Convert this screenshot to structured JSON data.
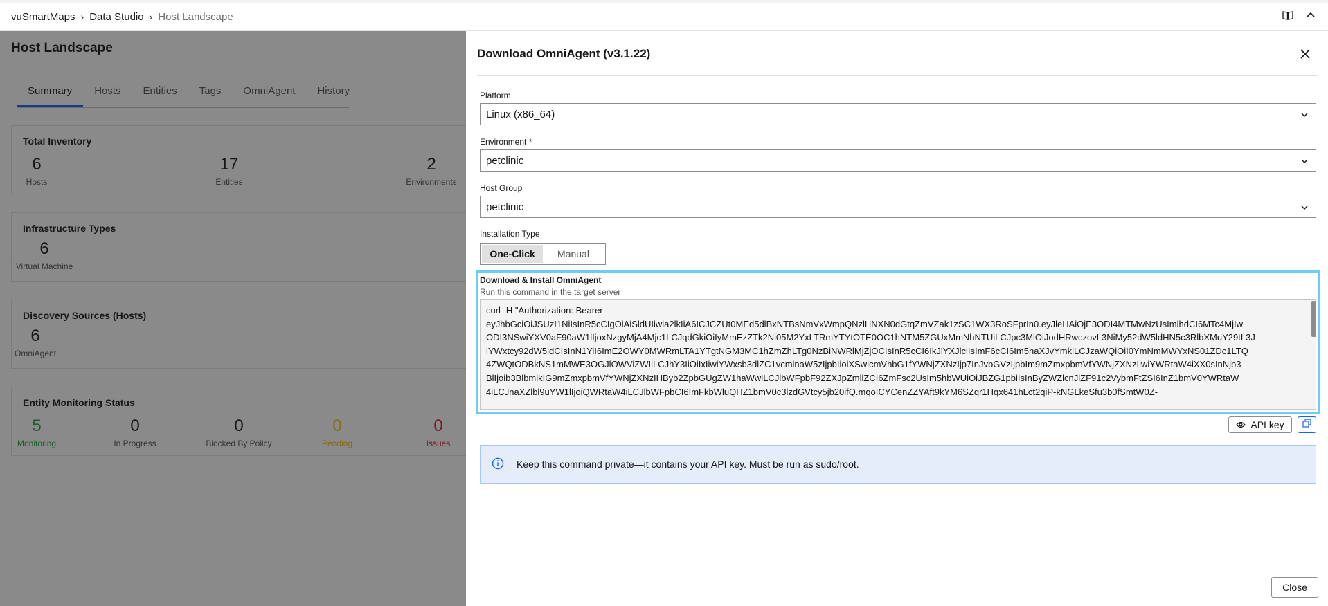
{
  "breadcrumb": [
    "vuSmartMaps",
    "Data Studio",
    "Host Landscape"
  ],
  "background": {
    "title": "Host Landscape",
    "tabs": [
      "Summary",
      "Hosts",
      "Entities",
      "Tags",
      "OmniAgent",
      "History"
    ],
    "total_inventory": {
      "title": "Total Inventory",
      "stats": [
        {
          "value": "6",
          "label": "Hosts"
        },
        {
          "value": "17",
          "label": "Entities"
        },
        {
          "value": "2",
          "label": "Environments"
        }
      ]
    },
    "infrastructure_types": {
      "title": "Infrastructure Types",
      "stats": [
        {
          "value": "6",
          "label": "Virtual Machine"
        }
      ]
    },
    "discovery_sources": {
      "title": "Discovery Sources (Hosts)",
      "stats": [
        {
          "value": "6",
          "label": "OmniAgent"
        }
      ]
    },
    "entity_monitoring": {
      "title": "Entity Monitoring Status",
      "stats": [
        {
          "value": "5",
          "label": "Monitoring",
          "color": "#24a148"
        },
        {
          "value": "0",
          "label": "In Progress",
          "color": "#161616"
        },
        {
          "value": "0",
          "label": "Blocked By Policy",
          "color": "#161616"
        },
        {
          "value": "0",
          "label": "Pending",
          "color": "#f1c21b"
        },
        {
          "value": "0",
          "label": "Issues",
          "color": "#da1e28"
        }
      ]
    }
  },
  "drawer": {
    "title": "Download OmniAgent (v3.1.22)",
    "platform": {
      "label": "Platform",
      "value": "Linux (x86_64)"
    },
    "environment": {
      "label": "Environment *",
      "value": "petclinic"
    },
    "host_group": {
      "label": "Host Group",
      "value": "petclinic"
    },
    "installation_type": {
      "label": "Installation Type",
      "options": [
        "One-Click",
        "Manual"
      ],
      "selected": "One-Click"
    },
    "command": {
      "title": "Download & Install OmniAgent",
      "subtitle": "Run this command in the target server",
      "lines": [
        "curl -H \"Authorization: Bearer",
        "eyJhbGciOiJSUzI1NiIsInR5cCIgOiAiSldUIiwia2lkIiA6ICJCZUt0MEd5dlBxNTBsNmVxWmpQNzlHNXN0dGtqZmVZak1zSC1WX3RoSFprIn0.eyJleHAiOjE3ODI4MTMwNzUsImlhdCI6MTc4MjIw",
        "ODI3NSwiYXV0aF90aW1lIjoxNzgyMjA4Mjc1LCJqdGkiOiIyMmEzZTk2Ni05M2YxLTRmYTYtOTE0OC1hNTM5ZGUxMmNhNTUiLCJpc3MiOiJodHRwczovL3NiMy52dW5ldHN5c3RlbXMuY29tL3J",
        "lYWxtcy92dW5ldCIsInN1YiI6ImE2OWY0MWRmLTA1YTgtNGM3MC1hZmZhLTg0NzBiNWRlMjZjOCIsInR5cCI6IkJlYXJlciIsImF6cCI6Im5haXJvYmkiLCJzaWQiOiI0YmNmMWYxNS01ZDc1LTQ",
        "4ZWQtODBkNS1mMWE3OGJlOWViZWIiLCJhY3IiOiIxIiwiYWxsb3dlZC1vcmlnaW5zIjpbIioiXSwicmVhbG1fYWNjZXNzIjp7InJvbGVzIjpbIm9mZmxpbmVfYWNjZXNzIiwiYWRtaW4iXX0sInNjb3",
        "BlIjoib3BlbmlkIG9mZmxpbmVfYWNjZXNzIHByb2ZpbGUgZW1haWwiLCJlbWFpbF92ZXJpZmllZCI6ZmFsc2UsIm5hbWUiOiJBZG1pbiIsInByZWZlcnJlZF91c2VybmFtZSI6InZ1bmV0YWRtaW",
        "4iLCJnaXZlbl9uYW1lIjoiQWRtaW4iLCJlbWFpbCI6ImFkbWluQHZ1bmV0c3lzdGVtcy5jb20ifQ.mqoICYCenZZYAft9kYM6SZqr1Hqx641hLct2qiP-kNGLkeSfu3b0fSmtW0Z-"
      ]
    },
    "api_key_button": "API key",
    "notice": "Keep this command private—it contains your API key. Must be run as sudo/root.",
    "close_button": "Close"
  }
}
